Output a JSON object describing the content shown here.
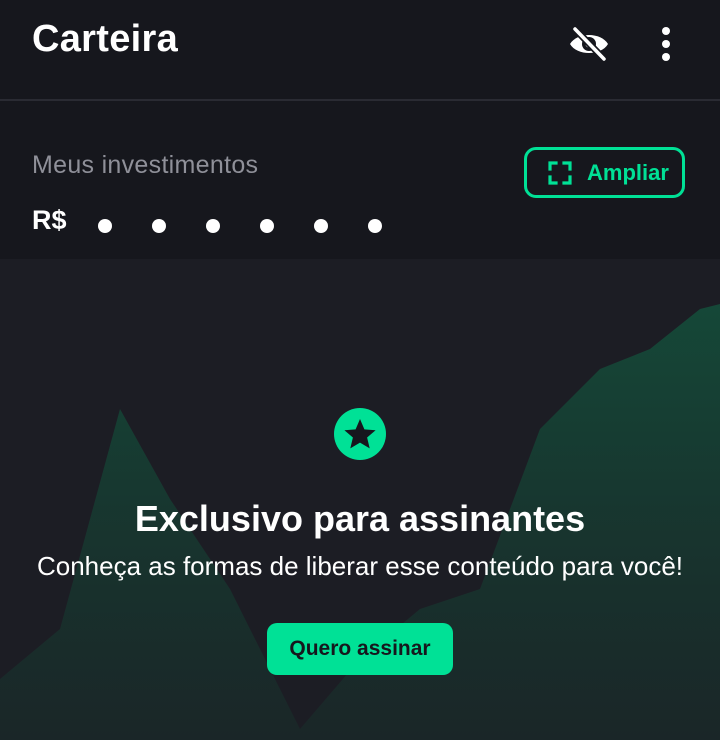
{
  "header": {
    "title": "Carteira",
    "hide_icon": "eye-off-icon",
    "menu_icon": "more-vertical-icon"
  },
  "investments": {
    "label": "Meus investimentos",
    "currency": "R$",
    "masked_digits": 6,
    "expand_button": {
      "icon": "expand-icon",
      "label": "Ampliar"
    }
  },
  "locked": {
    "badge_icon": "star-icon",
    "title": "Exclusivo para assinantes",
    "subtitle": "Conheça as formas de liberar esse conteúdo para você!",
    "cta_label": "Quero assinar"
  },
  "colors": {
    "background": "#16171d",
    "panel": "#1c1d24",
    "accent": "#00e196",
    "muted_text": "#8f9099"
  }
}
